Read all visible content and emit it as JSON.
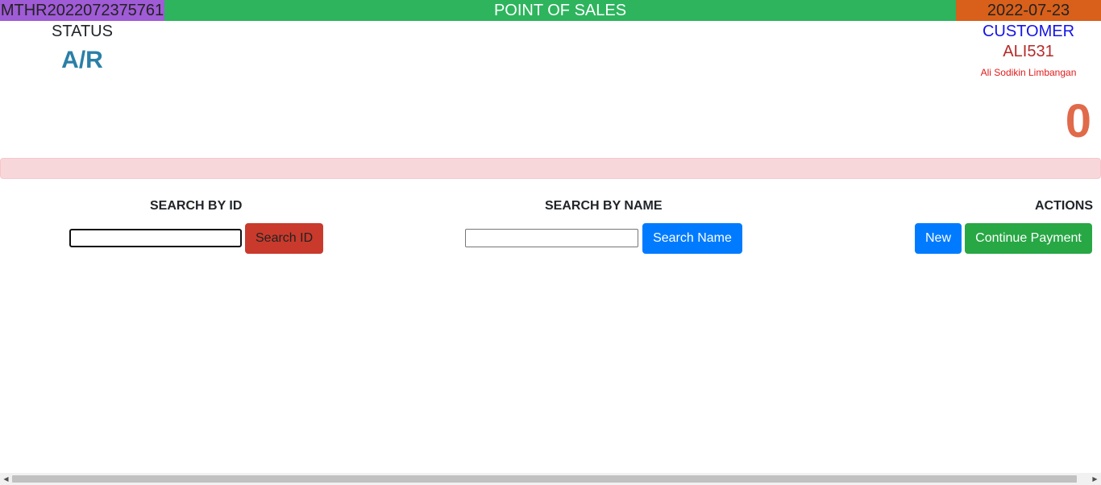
{
  "header": {
    "transaction_id": "MTHR2022072375761",
    "title": "POINT OF SALES",
    "date": "2022-07-23"
  },
  "status": {
    "label": "STATUS",
    "value": "A/R"
  },
  "customer": {
    "label": "CUSTOMER",
    "id": "ALI531",
    "name": "Ali Sodikin Limbangan"
  },
  "total": {
    "amount": "0"
  },
  "search_id": {
    "title": "SEARCH BY ID",
    "input_value": "",
    "button_label": "Search ID"
  },
  "search_name": {
    "title": "SEARCH BY NAME",
    "input_value": "",
    "button_label": "Search Name"
  },
  "actions": {
    "title": "ACTIONS",
    "new_label": "New",
    "continue_label": "Continue Payment"
  },
  "scrollbar": {
    "left_arrow": "◀",
    "right_arrow": "▶"
  },
  "colors": {
    "topbar": "#2db45d",
    "transaction_id_bg": "#a05bd6",
    "date_bg": "#d9601a",
    "status_value": "#2a7fa8",
    "customer_label": "#1414e6",
    "customer_id": "#b52a2a",
    "customer_name": "#e01b1b",
    "total": "#e06a4a",
    "alert_bg": "#f8d7da",
    "search_id_button": "#c93a2c",
    "primary_button": "#007bff",
    "success_button": "#28a745"
  }
}
